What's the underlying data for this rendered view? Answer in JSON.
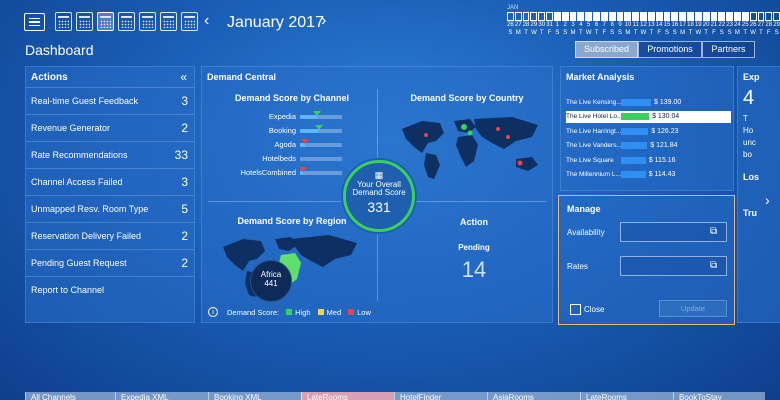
{
  "header": {
    "month": "January 2017",
    "prev_arrow": "‹",
    "next_arrow": "›",
    "page_title": "Dashboard"
  },
  "mini_calendar": {
    "month_label": "JAN",
    "day_numbers": [
      "26",
      "27",
      "28",
      "29",
      "30",
      "31",
      "1",
      "2",
      "3",
      "4",
      "5",
      "6",
      "7",
      "8",
      "9",
      "10",
      "11",
      "12",
      "13",
      "14",
      "15",
      "16",
      "17",
      "18",
      "19",
      "20",
      "21",
      "22",
      "23",
      "24",
      "25",
      "26",
      "27",
      "28",
      "29"
    ],
    "weekdays": [
      "S",
      "M",
      "T",
      "W",
      "T",
      "F",
      "S",
      "S",
      "M",
      "T",
      "W",
      "T",
      "F",
      "S",
      "S",
      "M",
      "T",
      "W",
      "T",
      "F",
      "S",
      "S",
      "M",
      "T",
      "W",
      "T",
      "F",
      "S",
      "S",
      "M",
      "T",
      "W",
      "T",
      "F",
      "S"
    ]
  },
  "top_tabs": [
    {
      "label": "Subscribed",
      "active": true
    },
    {
      "label": "Promotions",
      "active": false
    },
    {
      "label": "Partners",
      "active": false
    }
  ],
  "actions": {
    "title": "Actions",
    "collapse": "«",
    "items": [
      {
        "label": "Real-time Guest Feedback",
        "count": "3"
      },
      {
        "label": "Revenue Generator",
        "count": "2"
      },
      {
        "label": "Rate Recommendations",
        "count": "33"
      },
      {
        "label": "Channel Access Failed",
        "count": "3"
      },
      {
        "label": "Unmapped Resv. Room Type",
        "count": "5"
      },
      {
        "label": "Reservation Delivery Failed",
        "count": "2"
      },
      {
        "label": "Pending Guest Request",
        "count": "2"
      },
      {
        "label": "Report to Channel",
        "count": ""
      }
    ]
  },
  "demand_central": {
    "title": "Demand Central",
    "by_channel": {
      "title": "Demand Score by Channel",
      "channels": [
        {
          "name": "Expedia",
          "fill": 0.4,
          "trend": "up"
        },
        {
          "name": "Booking",
          "fill": 0.45,
          "trend": "up"
        },
        {
          "name": "Agoda",
          "fill": 0.12,
          "trend": "down"
        },
        {
          "name": "Hotelbeds",
          "fill": 0.0,
          "trend": "none"
        },
        {
          "name": "HotelsCombined",
          "fill": 0.08,
          "trend": "down"
        }
      ]
    },
    "by_country_title": "Demand Score by Country",
    "by_region": {
      "title": "Demand Score by Region",
      "region": "Africa",
      "value": "441"
    },
    "overall": {
      "label": "Your Overall Demand Score",
      "value": "331",
      "icon": "building-icon"
    },
    "action": {
      "title": "Action",
      "status": "Pending",
      "count": "14"
    },
    "legend": {
      "label": "Demand Score:",
      "high": "High",
      "med": "Med",
      "low": "Low",
      "colors": {
        "high": "#3ad05a",
        "med": "#f3d54e",
        "low": "#e2474b"
      }
    }
  },
  "market": {
    "title": "Market Analysis",
    "rows": [
      {
        "name": "The Live Kensing...",
        "value": "$ 139.00",
        "amount": 139.0,
        "selected": false
      },
      {
        "name": "The Live Hotel Lo...",
        "value": "$ 130.04",
        "amount": 130.04,
        "selected": true
      },
      {
        "name": "The Live Harringt...",
        "value": "$ 126.23",
        "amount": 126.23,
        "selected": false
      },
      {
        "name": "The Live Vanders...",
        "value": "$ 121.84",
        "amount": 121.84,
        "selected": false
      },
      {
        "name": "The Live Square",
        "value": "$ 115.16",
        "amount": 115.16,
        "selected": false
      },
      {
        "name": "The Millennium L...",
        "value": "$ 114.43",
        "amount": 114.43,
        "selected": false
      }
    ]
  },
  "manage": {
    "title": "Manage",
    "availability_label": "Availability",
    "rates_label": "Rates",
    "close_label": "Close",
    "update_label": "Update"
  },
  "right_panel": {
    "title": "Exp",
    "big": "4",
    "lines": [
      "T",
      "Ho",
      "unc",
      "bo"
    ],
    "los": "Los",
    "tru": "Tru"
  },
  "bottom_tabs": [
    {
      "label": "All Channels",
      "active": false
    },
    {
      "label": "Expedia XML",
      "active": false
    },
    {
      "label": "Booking XML",
      "active": false
    },
    {
      "label": "LateRooms",
      "active": true
    },
    {
      "label": "HotelFinder",
      "active": false
    },
    {
      "label": "AsiaRooms",
      "active": false
    },
    {
      "label": "LateRooms",
      "active": false
    },
    {
      "label": "BookToStay",
      "active": false
    }
  ]
}
